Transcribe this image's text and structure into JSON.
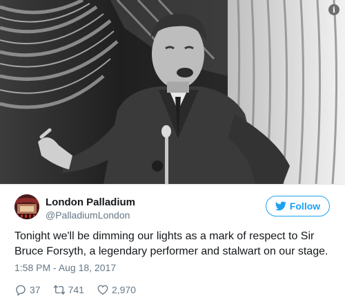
{
  "media": {
    "info_icon": "i"
  },
  "account": {
    "name": "London Palladium",
    "handle": "@PalladiumLondon",
    "avatar_icon": "theatre-avatar"
  },
  "follow_button": {
    "label": "Follow",
    "icon": "twitter-bird-icon",
    "color": "#1da1f2"
  },
  "tweet": {
    "text": "Tonight we'll be dimming our lights as a mark of respect to Sir Bruce Forsyth, a legendary performer and stalwart on our stage.",
    "timestamp": "1:58 PM - Aug 18, 2017"
  },
  "actions": {
    "replies": "37",
    "retweets": "741",
    "likes": "2,970"
  }
}
